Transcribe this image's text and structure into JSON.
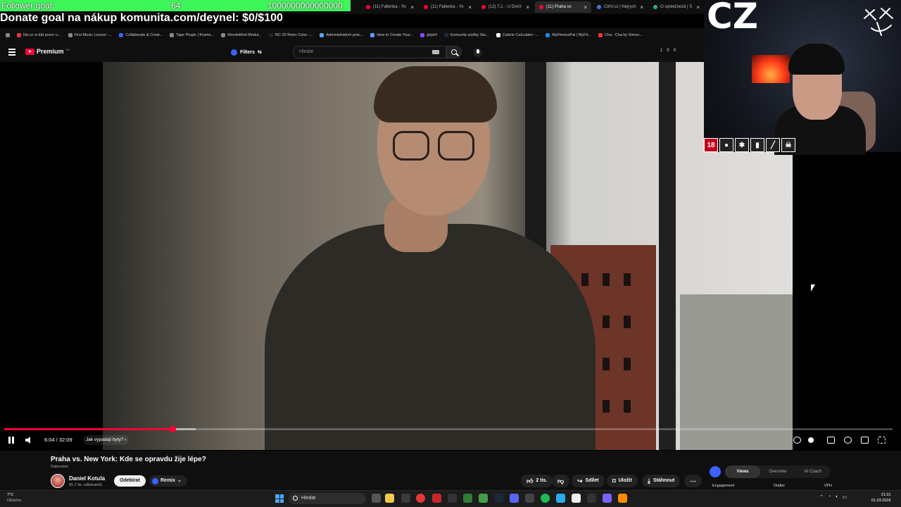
{
  "overlay": {
    "follower_label": "Follower goal:",
    "follower_count": "64",
    "follower_target": "1000000000000000",
    "follower_progress": 0.0,
    "donate_text": "Donate goal na nákup komunita.com/deynel: $0/$100",
    "webcam_label": "CZ",
    "icon_badge": "18"
  },
  "browser": {
    "tabs": [
      {
        "label": "(11) Fallenka - Yo",
        "active": false
      },
      {
        "label": "(11) Fallenka - Yo",
        "active": false
      },
      {
        "label": "(12) T.J. - U Don't",
        "active": false
      },
      {
        "label": "(11) Praha vs",
        "active": true
      },
      {
        "label": "CtrlV.cz | Nejrych",
        "active": false
      },
      {
        "label": "O společnosti | S",
        "active": false
      }
    ],
    "bookmarks": [
      "Na co si dát pozor u...",
      "First Music Lesson -...",
      "Collaborate & Creat...",
      "Tape Plugin | Krame...",
      "MondoMod Modul...",
      "RC-20 Retro Color -...",
      "Administrativní prác...",
      "How to Create Your...",
      "ghjshf",
      "Komunita služby Ste...",
      "Calorie Calculator -...",
      "MyFitnessPal | MyFit...",
      "Cha - Cha by Simon..."
    ]
  },
  "youtube": {
    "logo_text": "Premium",
    "country": "CZ",
    "filters_label": "Filters",
    "search_placeholder": "Hledat",
    "counters": [
      "1",
      "0",
      "0"
    ]
  },
  "player": {
    "current_time": "6:04",
    "duration": "32:09",
    "time_display": "6:04 / 32:09",
    "progress": 0.189,
    "chapter": "Jak vypadají byty?"
  },
  "video": {
    "title": "Praha vs. New York: Kde se opravdu žije lépe?",
    "dubbed": "Dabováno",
    "channel": "Daniel Kotula",
    "subscribers": "55,7 tis. odběratelů",
    "subscribe_label": "Odebírat",
    "remix_label": "Remix",
    "likes": "2 tis.",
    "share_label": "Sdílet",
    "save_label": "Uložit",
    "download_label": "Stáhnout"
  },
  "panel": {
    "tabs": [
      "Views",
      "Overview",
      "AI Coach"
    ],
    "active_tab": "Views",
    "labels": [
      "Engagement",
      "Outlier",
      "VPH"
    ]
  },
  "taskbar": {
    "temperature": "7°C",
    "weather": "Oblačno",
    "search_placeholder": "Hledat",
    "time": "21:31",
    "date": "01.03.2026"
  }
}
